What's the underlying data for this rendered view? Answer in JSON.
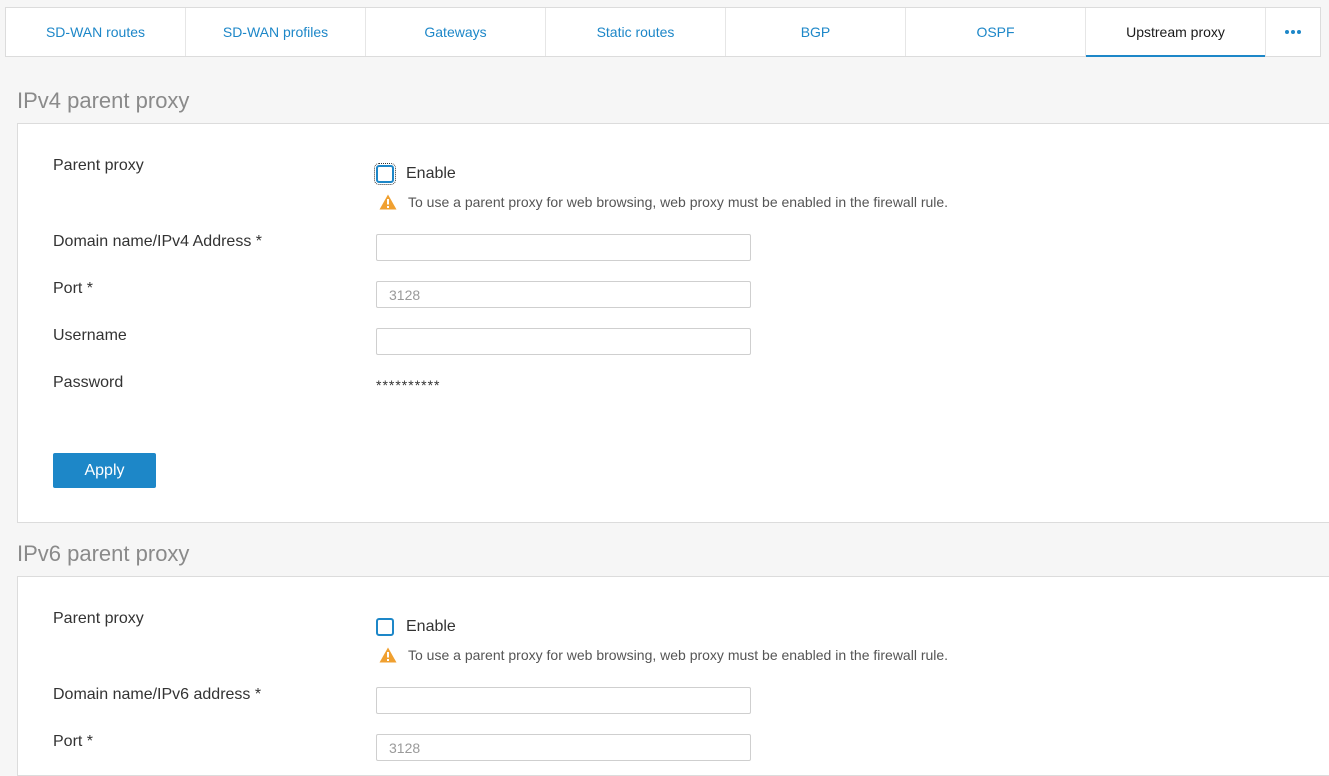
{
  "tabs": [
    {
      "label": "SD-WAN routes"
    },
    {
      "label": "SD-WAN profiles"
    },
    {
      "label": "Gateways"
    },
    {
      "label": "Static routes"
    },
    {
      "label": "BGP"
    },
    {
      "label": "OSPF"
    },
    {
      "label": "Upstream proxy",
      "active": true
    }
  ],
  "more_icon": "more-horizontal-icon",
  "colors": {
    "accent": "#1d87c8",
    "warning": "#f0a030"
  },
  "ipv4": {
    "title": "IPv4 parent proxy",
    "parent_proxy_label": "Parent proxy",
    "enable_label": "Enable",
    "enabled": false,
    "warning_icon": "warning-triangle-icon",
    "warning_text": "To use a parent proxy for web browsing, web proxy must be enabled in the firewall rule.",
    "address_label": "Domain name/IPv4 Address  *",
    "address_value": "",
    "port_label": "Port  *",
    "port_placeholder": "3128",
    "username_label": "Username",
    "username_value": "",
    "password_label": "Password",
    "password_value": "**********",
    "apply_label": "Apply"
  },
  "ipv6": {
    "title": "IPv6 parent proxy",
    "parent_proxy_label": "Parent proxy",
    "enable_label": "Enable",
    "enabled": false,
    "warning_icon": "warning-triangle-icon",
    "warning_text": "To use a parent proxy for web browsing, web proxy must be enabled in the firewall rule.",
    "address_label": "Domain name/IPv6 address *",
    "address_value": "",
    "port_label": "Port  *",
    "port_placeholder": "3128"
  }
}
